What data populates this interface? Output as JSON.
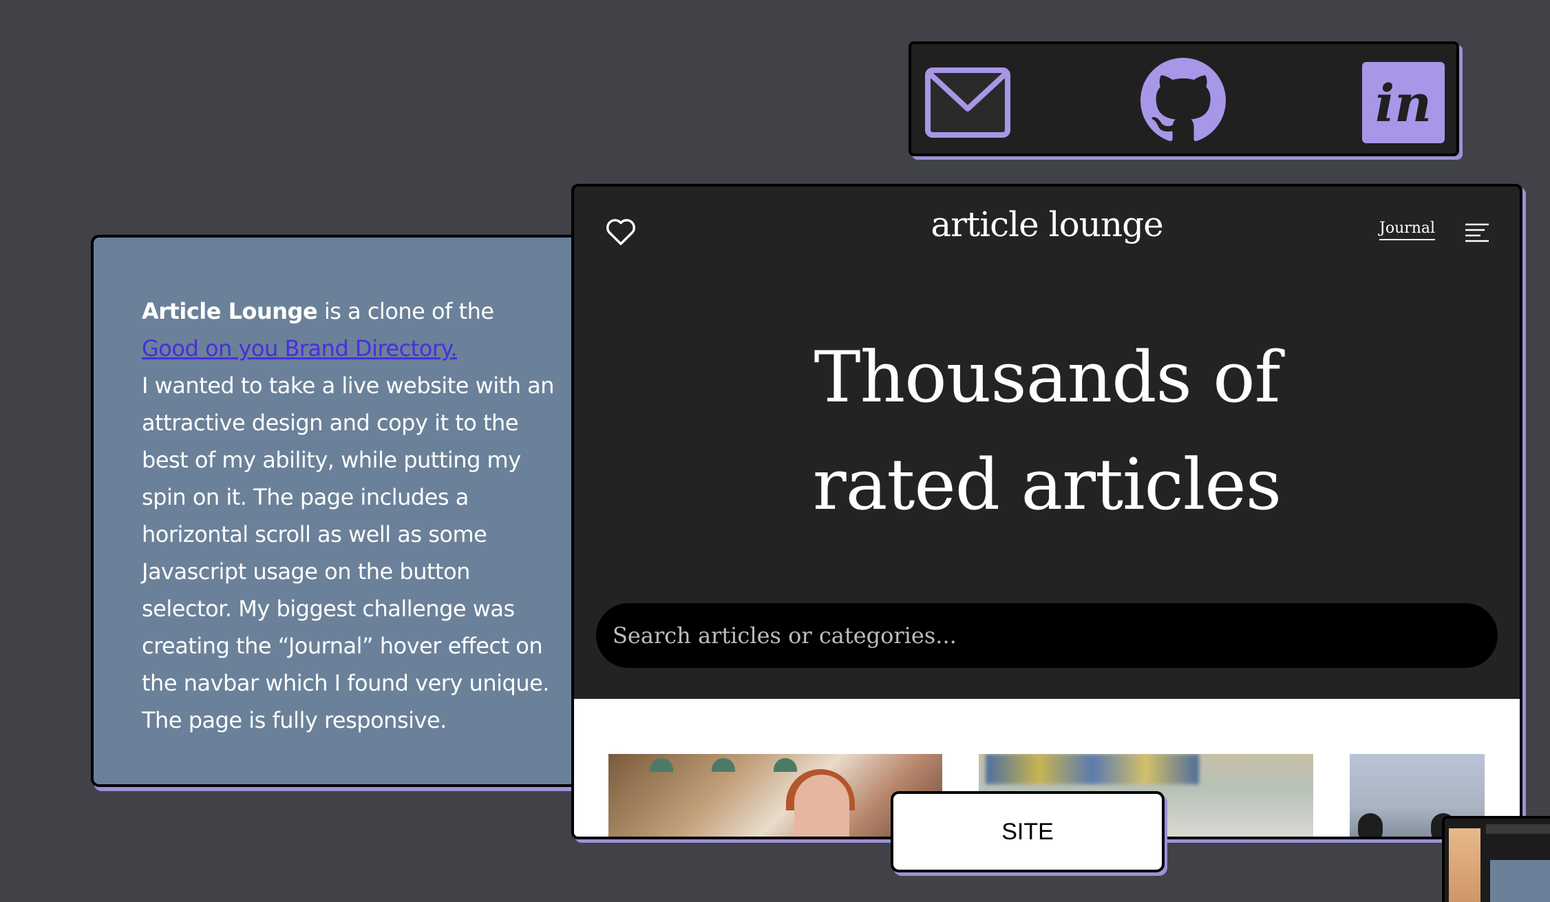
{
  "social": {
    "mail": "mail-icon",
    "github": "github-icon",
    "invision": "invision-icon",
    "invision_text": "in"
  },
  "description": {
    "bold_name": "Article Lounge",
    "intro": " is a clone of the ",
    "link_text": "Good on you Brand Directory.",
    "body": "I wanted to take a live website with an attractive design and copy it to the best of my ability, while putting my spin on it. The page includes a horizontal scroll as well as some Javascript usage on the button selector. My biggest challenge was creating the “Journal” hover effect on the navbar which I found very unique. The page is fully responsive."
  },
  "site": {
    "brand": "article lounge",
    "journal_label": "Journal",
    "hero_line1": "Thousands of",
    "hero_line2": "rated articles",
    "search_placeholder": "Search articles or categories..."
  },
  "buttons": {
    "site_label": "SITE"
  },
  "colors": {
    "background": "#414247",
    "accent": "#9e90d8",
    "card": "#6b8199",
    "link": "#4a2de0"
  }
}
